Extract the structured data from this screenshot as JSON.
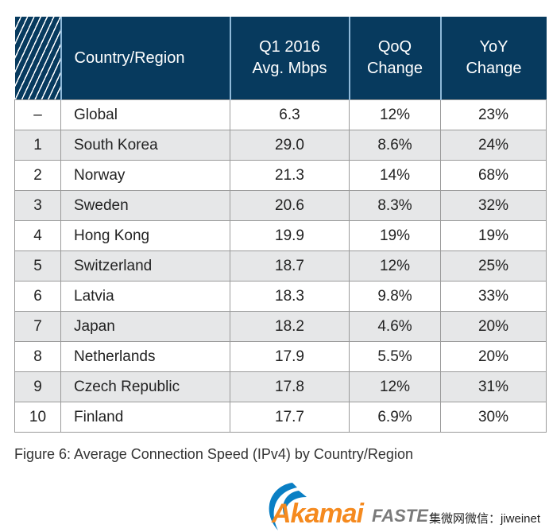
{
  "chart_data": {
    "type": "table",
    "columns": [
      "",
      "Country/Region",
      "Q1 2016 Avg. Mbps",
      "QoQ Change",
      "YoY Change"
    ],
    "header_lines": {
      "col2": [
        "Q1 2016",
        "Avg. Mbps"
      ],
      "col3": [
        "QoQ",
        "Change"
      ],
      "col4": [
        "YoY",
        "Change"
      ]
    },
    "rows": [
      [
        "–",
        "Global",
        "6.3",
        "12%",
        "23%"
      ],
      [
        "1",
        "South Korea",
        "29.0",
        "8.6%",
        "24%"
      ],
      [
        "2",
        "Norway",
        "21.3",
        "14%",
        "68%"
      ],
      [
        "3",
        "Sweden",
        "20.6",
        "8.3%",
        "32%"
      ],
      [
        "4",
        "Hong Kong",
        "19.9",
        "19%",
        "19%"
      ],
      [
        "5",
        "Switzerland",
        "18.7",
        "12%",
        "25%"
      ],
      [
        "6",
        "Latvia",
        "18.3",
        "9.8%",
        "33%"
      ],
      [
        "7",
        "Japan",
        "18.2",
        "4.6%",
        "20%"
      ],
      [
        "8",
        "Netherlands",
        "17.9",
        "5.5%",
        "20%"
      ],
      [
        "9",
        "Czech Republic",
        "17.8",
        "12%",
        "31%"
      ],
      [
        "10",
        "Finland",
        "17.7",
        "6.9%",
        "30%"
      ]
    ],
    "caption": "Figure 6: Average Connection Speed (IPv4) by Country/Region",
    "colors": {
      "header": "#073a5e",
      "alt_row": "#e6e7e8",
      "logo_orange": "#f58a1f",
      "logo_blue": "#0a7fc4"
    }
  },
  "logo": {
    "brand": "Akamai",
    "tagline": "FASTE",
    "watermark": "集微网微信：jiweinet"
  }
}
